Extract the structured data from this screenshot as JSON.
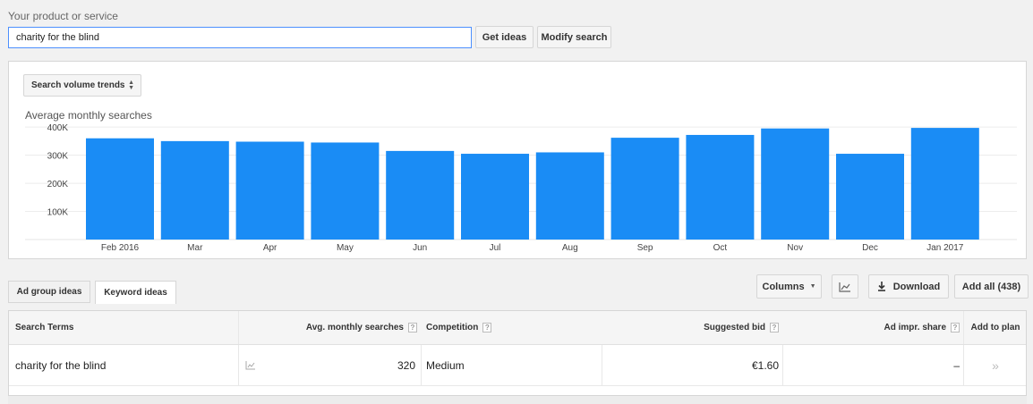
{
  "search": {
    "label": "Your product or service",
    "value": "charity for the blind",
    "get_ideas_label": "Get ideas",
    "modify_search_label": "Modify search"
  },
  "chart_panel": {
    "select_label": "Search volume trends"
  },
  "chart_data": {
    "type": "bar",
    "title": "Average monthly searches",
    "xlabel": "",
    "ylabel": "",
    "ylim": [
      0,
      410000
    ],
    "yticks": [
      100000,
      200000,
      300000,
      400000
    ],
    "ytick_labels": [
      "100K",
      "200K",
      "300K",
      "400K"
    ],
    "categories": [
      "Feb 2016",
      "Mar",
      "Apr",
      "May",
      "Jun",
      "Jul",
      "Aug",
      "Sep",
      "Oct",
      "Nov",
      "Dec",
      "Jan 2017"
    ],
    "values": [
      360000,
      350000,
      348000,
      345000,
      315000,
      305000,
      310000,
      362000,
      372000,
      395000,
      305000,
      397000
    ],
    "bar_color": "#1a8cf5",
    "grid": true
  },
  "tabs": [
    {
      "label": "Ad group ideas",
      "active": false
    },
    {
      "label": "Keyword ideas",
      "active": true
    }
  ],
  "toolbar": {
    "columns_label": "Columns",
    "download_label": "Download",
    "add_all_label": "Add all (438)"
  },
  "table": {
    "headers": {
      "search_terms": "Search Terms",
      "avg_monthly": "Avg. monthly searches",
      "competition": "Competition",
      "suggested_bid": "Suggested bid",
      "ad_impr_share": "Ad impr. share",
      "add_to_plan": "Add to plan"
    },
    "help_glyph": "?",
    "rows": [
      {
        "term": "charity for the blind",
        "avg_monthly": "320",
        "competition": "Medium",
        "suggested_bid": "€1.60",
        "ad_impr_share": "–",
        "add_glyph": "»"
      }
    ]
  }
}
